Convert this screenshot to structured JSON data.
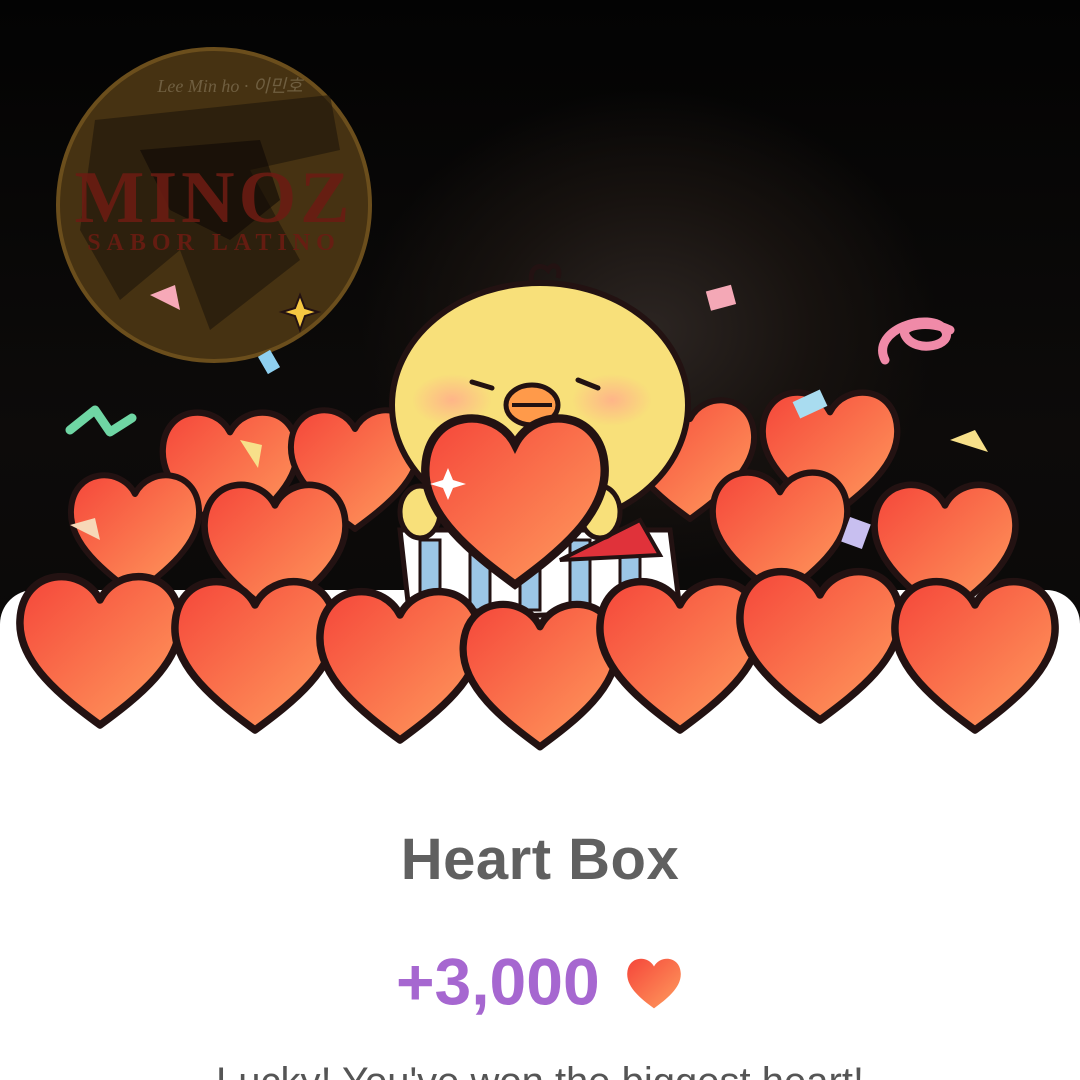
{
  "watermark": {
    "signature": "Lee Min ho · 이민호",
    "brand": "MINOZ",
    "tagline": "SABOR LATINO"
  },
  "popup": {
    "title": "Heart Box",
    "reward_amount": "+3,000",
    "reward_icon": "heart-icon",
    "subtitle": "Lucky! You've won the biggest heart!"
  },
  "colors": {
    "title": "#606060",
    "reward": "#a667d0",
    "heart_light": "#ff9a5c",
    "heart_dark": "#f0463c",
    "chick": "#f8e07a"
  }
}
